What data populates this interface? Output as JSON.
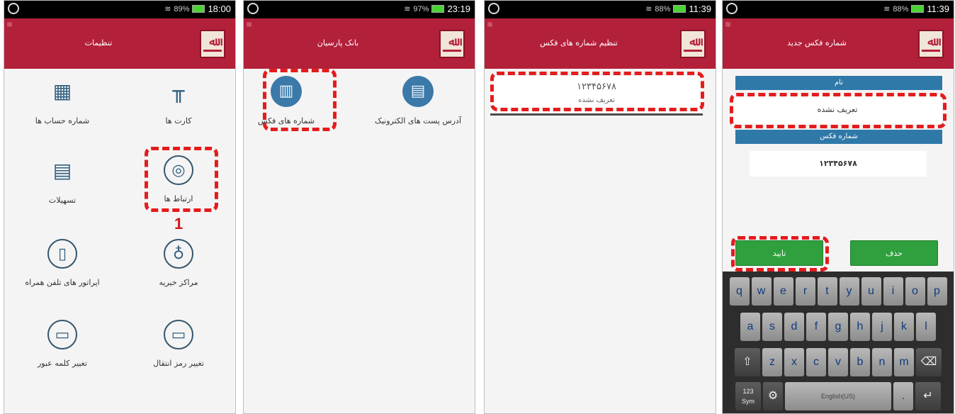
{
  "status_bars": [
    {
      "time": "18:00",
      "signal": "89%"
    },
    {
      "time": "23:19",
      "signal": "97%"
    },
    {
      "time": "11:39",
      "signal": "88%"
    },
    {
      "time": "11:39",
      "signal": "88%"
    }
  ],
  "screen1": {
    "title": "تنظیمات",
    "items": [
      {
        "label": "شماره حساب ها",
        "icon": "document-grid-icon"
      },
      {
        "label": "کارت ها",
        "icon": "card-icon"
      },
      {
        "label": "تسهیلات",
        "icon": "money-icon"
      },
      {
        "label": "ارتباط ها",
        "icon": "connection-icon"
      },
      {
        "label": "اپراتور های تلفن همراه",
        "icon": "mobile-phone-icon"
      },
      {
        "label": "مراکز خیریه",
        "icon": "charity-hand-icon"
      },
      {
        "label": "تغییر کلمه عبور",
        "icon": "chat-icon"
      },
      {
        "label": "تغییر رمز انتقال",
        "icon": "chat-icon"
      }
    ],
    "step_marker": "1"
  },
  "screen2": {
    "title": "بانک پارسیان",
    "items": [
      {
        "label": "شماره های فکس",
        "icon": "fax-icon"
      },
      {
        "label": "آدرس پست های الکترونیک",
        "icon": "email-icon"
      }
    ]
  },
  "screen3": {
    "title": "تنظیم شماره های فکس",
    "entry_number": "۱۲۳۴۵۶۷۸",
    "entry_name": "تعریف نشده"
  },
  "screen4": {
    "title": "شماره فکس جدید",
    "name_label": "نام",
    "name_value": "تعریف نشده",
    "fax_label": "شماره فکس",
    "fax_value": "۱۲۳۴۵۶۷۸",
    "confirm_button": "تایید",
    "delete_button": "حذف",
    "keyboard": {
      "row1": [
        "q",
        "w",
        "e",
        "r",
        "t",
        "y",
        "u",
        "i",
        "o",
        "p"
      ],
      "row2": [
        "a",
        "s",
        "d",
        "f",
        "g",
        "h",
        "j",
        "k",
        "l"
      ],
      "row3": [
        "z",
        "x",
        "c",
        "v",
        "b",
        "n",
        "m"
      ],
      "sym_key": "123\nSym",
      "space_label": "English(US)"
    }
  }
}
